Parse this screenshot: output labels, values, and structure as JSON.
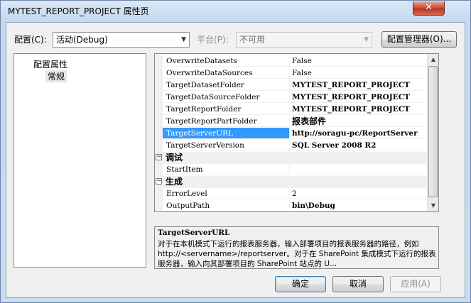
{
  "window": {
    "title": "MYTEST_REPORT_PROJECT 属性页",
    "close_glyph": "✕"
  },
  "toolbar": {
    "config_label": "配置(C):",
    "config_value": "活动(Debug)",
    "platform_label": "平台(P):",
    "platform_value": "不可用",
    "config_manager_label": "配置管理器(O)..."
  },
  "tree": {
    "root": "配置属性",
    "child": "常规"
  },
  "grid": {
    "rows": [
      {
        "name": "OverwriteDatasets",
        "value": "False",
        "bold": false
      },
      {
        "name": "OverwriteDataSources",
        "value": "False",
        "bold": false
      },
      {
        "name": "TargetDatasetFolder",
        "value": "MYTEST_REPORT_PROJECT",
        "bold": true
      },
      {
        "name": "TargetDataSourceFolder",
        "value": "MYTEST_REPORT_PROJECT",
        "bold": true
      },
      {
        "name": "TargetReportFolder",
        "value": "MYTEST_REPORT_PROJECT",
        "bold": true
      },
      {
        "name": "TargetReportPartFolder",
        "value": "报表部件",
        "bold": true
      },
      {
        "name": "TargetServerURL",
        "value": "http://soragu-pc/ReportServer",
        "bold": true
      },
      {
        "name": "TargetServerVersion",
        "value": "SQL Server 2008 R2",
        "bold": true
      }
    ],
    "cat_debug": "调试",
    "debug_rows": [
      {
        "name": "StartItem",
        "value": ""
      }
    ],
    "cat_build": "生成",
    "build_rows": [
      {
        "name": "ErrorLevel",
        "value": "2",
        "bold": false
      },
      {
        "name": "OutputPath",
        "value": "bin\\Debug",
        "bold": true
      }
    ],
    "collapse_glyph": "−"
  },
  "description": {
    "title": "TargetServerURL",
    "text": "对于在本机模式下运行的报表服务器，输入部署项目的报表服务器的路径，例如 http://<servername>/reportserver。对于在 SharePoint 集成模式下运行的报表服务器，输入向其部署项目的 SharePoint 站点的 U..."
  },
  "buttons": {
    "ok": "确定",
    "cancel": "取消",
    "apply": "应用(A)"
  }
}
